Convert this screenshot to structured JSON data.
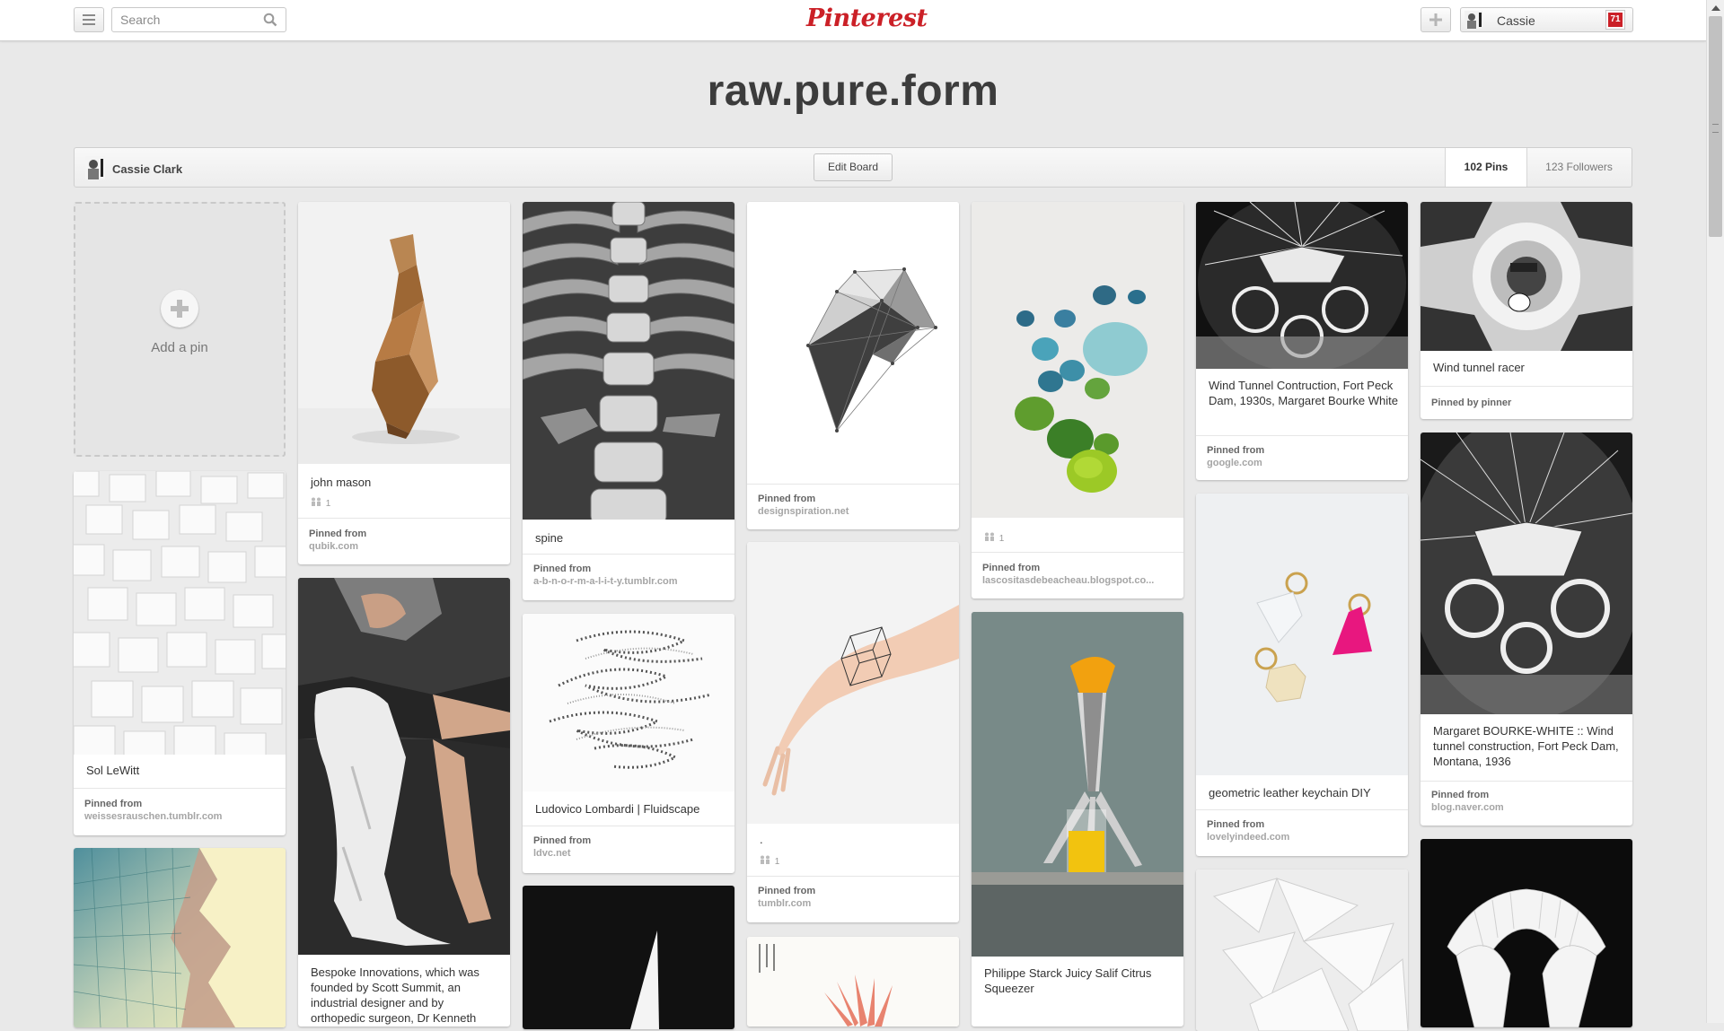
{
  "topbar": {
    "search_placeholder": "Search",
    "logo_text": "Pinterest",
    "user_name": "Cassie",
    "notification_count": "71",
    "icons": [
      "menu-icon",
      "search-icon",
      "plus-icon",
      "avatar",
      "notification-badge"
    ]
  },
  "board": {
    "title": "raw.pure.form",
    "owner": "Cassie Clark",
    "edit_label": "Edit Board",
    "pins_label": "102 Pins",
    "followers_label": "123 Followers"
  },
  "add_pin_label": "Add a pin",
  "pins": [
    {
      "desc": "Sol LeWitt",
      "from_label": "Pinned from",
      "source": "weissesrauschen.tumblr.com"
    },
    {
      "desc": "john mason",
      "meta": "1",
      "from_label": "Pinned from",
      "source": "qubik.com"
    },
    {
      "desc": "Bespoke Innovations, which was founded by Scott Summit, an industrial designer and by orthopedic surgeon, Dr Kenneth"
    },
    {
      "desc": "spine",
      "from_label": "Pinned from",
      "source": "a-b-n-o-r-m-a-l-i-t-y.tumblr.com"
    },
    {
      "desc": "Ludovico Lombardi | Fluidscape",
      "from_label": "Pinned from",
      "source": "ldvc.net"
    },
    {
      "from_label": "Pinned from",
      "source": "designspiration.net"
    },
    {
      "desc": ".",
      "meta": "1",
      "from_label": "Pinned from",
      "source": "tumblr.com"
    },
    {
      "meta": "1",
      "from_label": "Pinned from",
      "source": "lascositasdebeacheau.blogspot.co..."
    },
    {
      "desc": "Philippe Starck Juicy Salif Citrus Squeezer"
    },
    {
      "desc": "Wind Tunnel Contruction, Fort Peck Dam, 1930s, Margaret Bourke White",
      "from_label": "Pinned from",
      "source": "google.com"
    },
    {
      "desc": "geometric leather keychain DIY",
      "from_label": "Pinned from",
      "source": "lovelyindeed.com"
    },
    {
      "desc": "Wind tunnel racer",
      "from_label": "Pinned by pinner"
    },
    {
      "desc": "Margaret BOURKE-WHITE :: Wind tunnel construction, Fort Peck Dam, Montana, 1936",
      "from_label": "Pinned from",
      "source": "blog.naver.com"
    }
  ]
}
